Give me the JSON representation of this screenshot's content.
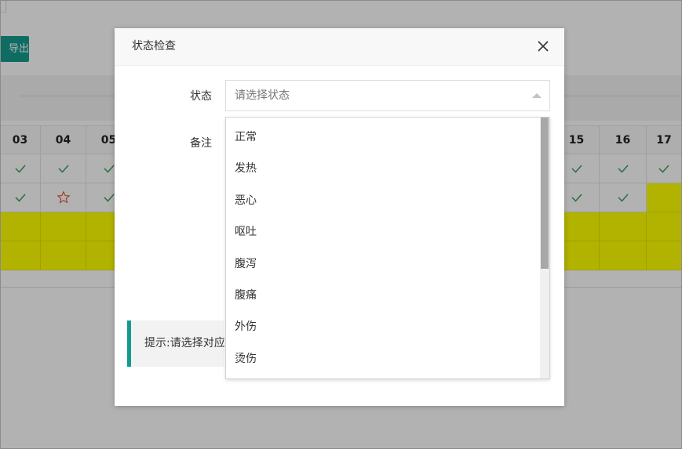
{
  "background": {
    "export_label": "导出",
    "columns": [
      "03",
      "04",
      "05",
      "15",
      "16",
      "17"
    ],
    "row1_marks": [
      "check",
      "check",
      "check",
      "check",
      "check",
      "check"
    ],
    "row2_marks": [
      "check",
      "star",
      "check",
      "check",
      "check",
      "highlight"
    ],
    "highlight_color": "#ffff00",
    "accent_color": "#159b8e"
  },
  "dialog": {
    "title": "状态检查",
    "close_icon": "close-icon",
    "status_label": "状态",
    "status_placeholder": "请选择状态",
    "remark_label": "备注",
    "tip_text": "提示:请选择对应",
    "options": [
      "正常",
      "发热",
      "恶心",
      "呕吐",
      "腹泻",
      "腹痛",
      "外伤",
      "烫伤"
    ]
  }
}
